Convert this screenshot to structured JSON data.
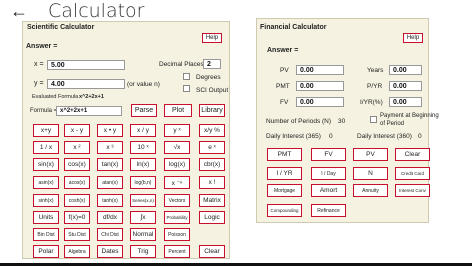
{
  "header": {
    "back_glyph": "←",
    "title": "Calculator"
  },
  "sci": {
    "title": "Scientific Calculator",
    "help": "Help",
    "answer_label": "Answer =",
    "x_label": "x =",
    "x_value": "5.00",
    "y_label": "y =",
    "y_value": "4.00",
    "y_note": "(or value n)",
    "decimal_label": "Decimal Places",
    "decimal_value": "2",
    "degrees_label": "Degrees",
    "sci_output_label": "SCI Output",
    "evaluated_label": "Evaluated Formula",
    "evaluated_value": "x^2+2x+1",
    "formula_label": "Formula =",
    "formula_value": "x^2+2x+1",
    "action_buttons": [
      "Parse",
      "Plot",
      "Library"
    ],
    "grid": [
      [
        "x+y",
        "x - y",
        "x • y",
        "x / y",
        "y ˣ",
        "x/y %"
      ],
      [
        "1 / x",
        "x ²",
        "x ³",
        "10 ˣ",
        "√x",
        "e ˣ"
      ],
      [
        "sin(x)",
        "cos(x)",
        "tan(x)",
        "ln(x)",
        "log(x)",
        "cbr(x)"
      ],
      [
        "asin(x)",
        "acos(x)",
        "atan(x)",
        "log(b,n)",
        "x ⁻ⁿ",
        "x !"
      ],
      [
        "sinh(x)",
        "cosh(x)",
        "tanh(x)",
        "Series(x,n)",
        "Vectors",
        "Matrix"
      ],
      [
        "Units",
        "f(x)=0",
        "df/dx",
        "∫x",
        "Probability",
        "Logic"
      ],
      [
        "Bin Dist",
        "Stu Dist",
        "Chi Dist",
        "Normal",
        "Poisson",
        ""
      ],
      [
        "Polar",
        "Algebra",
        "Dates",
        "Trig",
        "Percent",
        "Clear"
      ]
    ]
  },
  "fin": {
    "title": "Financial Calculator",
    "help": "Help",
    "answer_label": "Answer =",
    "pv_label": "PV",
    "pv_value": "0.00",
    "pmt_label": "PMT",
    "pmt_value": "0.00",
    "fv_label": "FV",
    "fv_value": "0.00",
    "years_label": "Years",
    "years_value": "0.00",
    "pyr_label": "P/YR",
    "pyr_value": "0.00",
    "iyr_label": "I/YR(%)",
    "iyr_value": "0.00",
    "periods_label": "Number of Periods (N)",
    "periods_value": "30",
    "payment_label_1": "Payment at Beginning",
    "payment_label_2": "of Period",
    "daily365_label": "Daily Interest (365)",
    "daily365_value": "0",
    "daily360_label": "Daily Interest (360)",
    "daily360_value": "0",
    "grid": [
      [
        "PMT",
        "FV",
        "PV",
        "Clear"
      ],
      [
        "I / YR",
        "I / Day",
        "N",
        "Credit Card"
      ],
      [
        "Mortgage",
        "Amort",
        "Annuity",
        "Interest Conv"
      ],
      [
        "Compounding",
        "Refinance"
      ]
    ]
  }
}
